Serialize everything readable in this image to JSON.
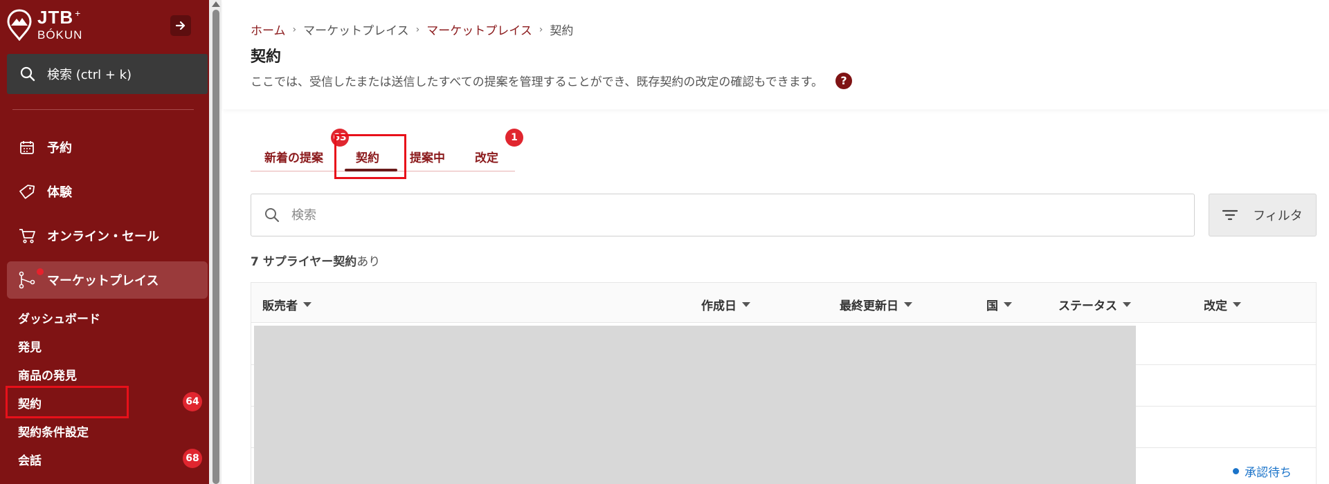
{
  "brand": {
    "name": "JTB",
    "plus": "+",
    "sub": "BÓKUN"
  },
  "sidebar": {
    "search_label": "検索 (ctrl + k)",
    "nav": [
      {
        "label": "予約",
        "icon": "calendar-icon"
      },
      {
        "label": "体験",
        "icon": "tag-icon"
      },
      {
        "label": "オンライン・セール",
        "icon": "cart-icon"
      },
      {
        "label": "マーケットプレイス",
        "icon": "network-icon"
      }
    ],
    "subitems": [
      {
        "label": "ダッシュボード"
      },
      {
        "label": "発見"
      },
      {
        "label": "商品の発見"
      },
      {
        "label": "契約",
        "badge": "64"
      },
      {
        "label": "契約条件設定"
      },
      {
        "label": "会話",
        "badge": "68"
      }
    ]
  },
  "breadcrumb": [
    "ホーム",
    "マーケットプレイス",
    "マーケットプレイス",
    "契約"
  ],
  "page": {
    "title": "契約",
    "description": "ここでは、受信したまたは送信したすべての提案を管理することができ、既存契約の改定の確認もできます。",
    "help": "?"
  },
  "tabs": [
    {
      "label": "新着の提案",
      "badge": "63"
    },
    {
      "label": "契約"
    },
    {
      "label": "提案中"
    },
    {
      "label": "改定",
      "badge": "1"
    }
  ],
  "search": {
    "placeholder": "検索"
  },
  "filter": {
    "label": "フィルタ"
  },
  "summary": {
    "count": "7 サプライヤー契約",
    "suffix": "あり"
  },
  "table": {
    "columns": [
      "販売者",
      "作成日",
      "最終更新日",
      "国",
      "ステータス",
      "改定"
    ],
    "visible_status": "承認待ち"
  },
  "colors": {
    "sidebar": "#7f1314",
    "accent": "#8b1a1c",
    "badge": "#e0262f",
    "highlight": "#e8101a",
    "status_blue": "#1a73c9"
  }
}
